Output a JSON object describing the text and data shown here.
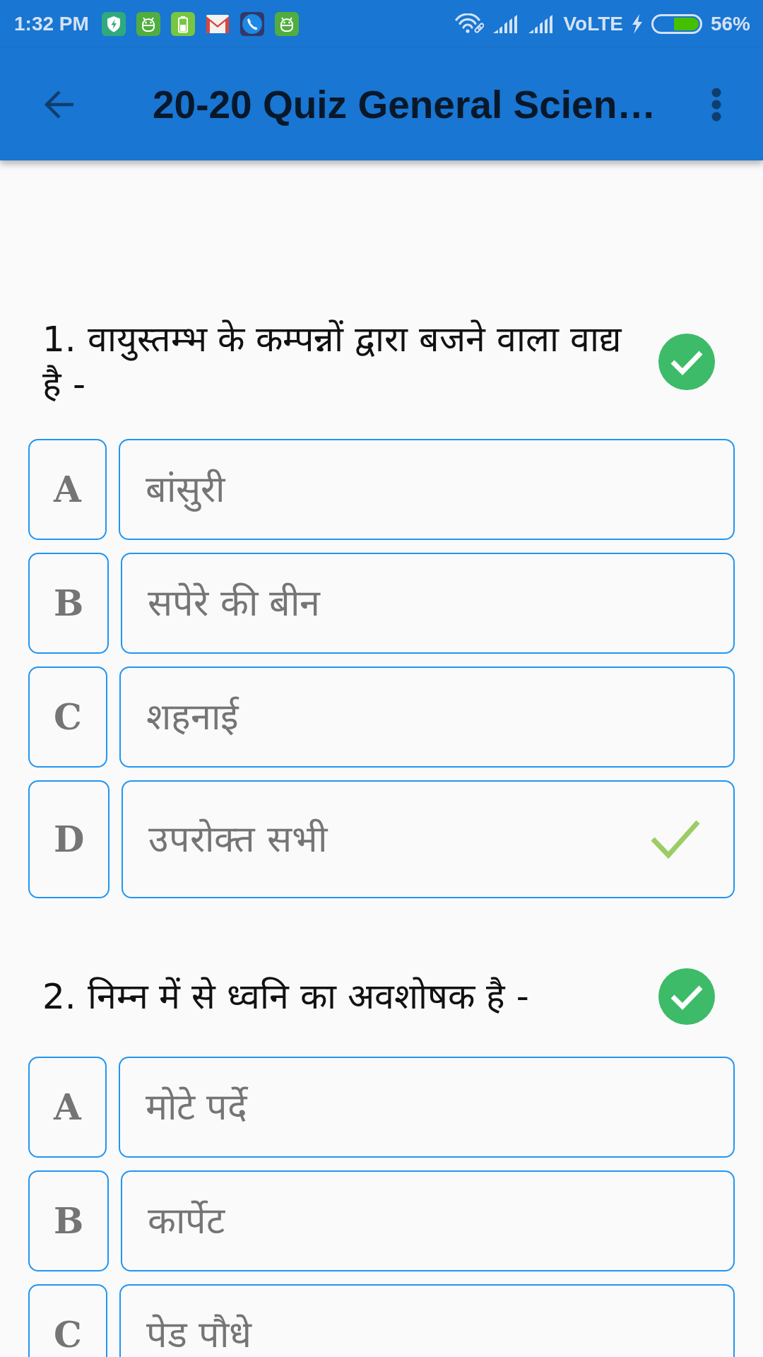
{
  "status_bar": {
    "time": "1:32 PM",
    "network": "VoLTE",
    "battery": "56%"
  },
  "app_bar": {
    "title": "20-20 Quiz General Scien…"
  },
  "questions": [
    {
      "text": "1. वायुस्तम्भ के कम्पन्नों द्वारा बजने वाला वाद्य है -",
      "correct": true,
      "options": [
        {
          "letter": "A",
          "text": "बांसुरी",
          "correct": false
        },
        {
          "letter": "B",
          "text": "सपेरे की बीन",
          "correct": false
        },
        {
          "letter": "C",
          "text": "शहनाई",
          "correct": false
        },
        {
          "letter": "D",
          "text": "उपरोक्त सभी",
          "correct": true
        }
      ]
    },
    {
      "text": "2. निम्न में से ध्वनि का अवशोषक है -",
      "correct": true,
      "options": [
        {
          "letter": "A",
          "text": "मोटे पर्दे",
          "correct": false
        },
        {
          "letter": "B",
          "text": "कार्पेट",
          "correct": false
        },
        {
          "letter": "C",
          "text": "पेड पौधे",
          "correct": false
        }
      ]
    }
  ]
}
